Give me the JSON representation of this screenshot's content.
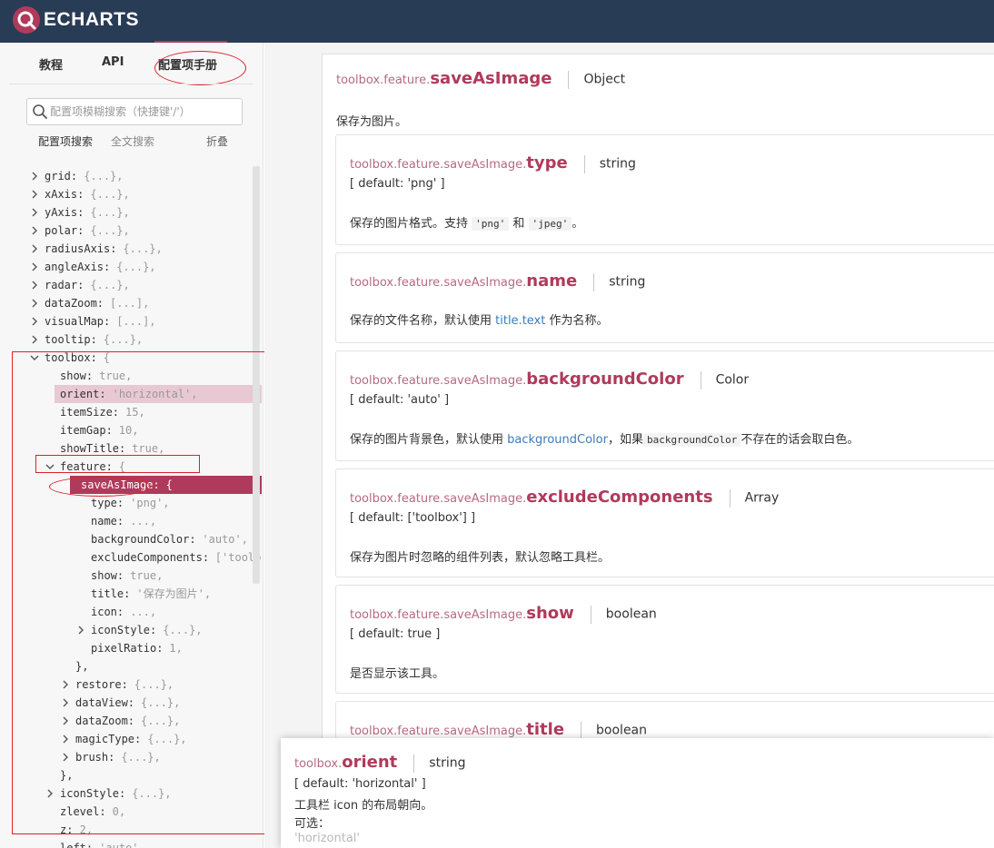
{
  "app": {
    "logo_text": "ECHARTS",
    "brand_color": "#b03a5b",
    "topbar_color": "#293c55"
  },
  "nav": {
    "tabs": [
      {
        "label": "教程"
      },
      {
        "label": "API"
      },
      {
        "label": "配置项手册",
        "active": true
      }
    ]
  },
  "search": {
    "placeholder": "配置项模糊搜索（快捷键'/'）",
    "modes": [
      {
        "label": "配置项搜索",
        "active": true
      },
      {
        "label": "全文搜索"
      }
    ],
    "collapse_label": "折叠"
  },
  "tree": [
    {
      "indent": 0,
      "arrow": "right",
      "key": "grid:",
      "val": "{...},",
      "hl": ""
    },
    {
      "indent": 0,
      "arrow": "right",
      "key": "xAxis:",
      "val": "{...},",
      "hl": ""
    },
    {
      "indent": 0,
      "arrow": "right",
      "key": "yAxis:",
      "val": "{...},",
      "hl": ""
    },
    {
      "indent": 0,
      "arrow": "right",
      "key": "polar:",
      "val": "{...},",
      "hl": ""
    },
    {
      "indent": 0,
      "arrow": "right",
      "key": "radiusAxis:",
      "val": "{...},",
      "hl": ""
    },
    {
      "indent": 0,
      "arrow": "right",
      "key": "angleAxis:",
      "val": "{...},",
      "hl": ""
    },
    {
      "indent": 0,
      "arrow": "right",
      "key": "radar:",
      "val": "{...},",
      "hl": ""
    },
    {
      "indent": 0,
      "arrow": "right",
      "key": "dataZoom:",
      "val": "[...],",
      "hl": ""
    },
    {
      "indent": 0,
      "arrow": "right",
      "key": "visualMap:",
      "val": "[...],",
      "hl": ""
    },
    {
      "indent": 0,
      "arrow": "right",
      "key": "tooltip:",
      "val": "{...},",
      "hl": ""
    },
    {
      "indent": 0,
      "arrow": "down",
      "key": "toolbox:",
      "val": "{",
      "hl": ""
    },
    {
      "indent": 1,
      "arrow": "",
      "key": "show:",
      "val": "true,",
      "hl": ""
    },
    {
      "indent": 1,
      "arrow": "",
      "key": "orient:",
      "val": "'horizontal',",
      "hl": "light"
    },
    {
      "indent": 1,
      "arrow": "",
      "key": "itemSize:",
      "val": "15,",
      "hl": ""
    },
    {
      "indent": 1,
      "arrow": "",
      "key": "itemGap:",
      "val": "10,",
      "hl": ""
    },
    {
      "indent": 1,
      "arrow": "",
      "key": "showTitle:",
      "val": "true,",
      "hl": ""
    },
    {
      "indent": 1,
      "arrow": "down",
      "key": "feature:",
      "val": "{",
      "hl": ""
    },
    {
      "indent": 2,
      "arrow": "down",
      "key": "saveAsImage:",
      "val": "{",
      "hl": "dark"
    },
    {
      "indent": 3,
      "arrow": "",
      "key": "type:",
      "val": "'png',",
      "hl": ""
    },
    {
      "indent": 3,
      "arrow": "",
      "key": "name:",
      "val": "...,",
      "hl": ""
    },
    {
      "indent": 3,
      "arrow": "",
      "key": "backgroundColor:",
      "val": "'auto',",
      "hl": ""
    },
    {
      "indent": 3,
      "arrow": "",
      "key": "excludeComponents:",
      "val": "['toolbox'],",
      "hl": ""
    },
    {
      "indent": 3,
      "arrow": "",
      "key": "show:",
      "val": "true,",
      "hl": ""
    },
    {
      "indent": 3,
      "arrow": "",
      "key": "title:",
      "val": "'保存为图片',",
      "hl": ""
    },
    {
      "indent": 3,
      "arrow": "",
      "key": "icon:",
      "val": "...,",
      "hl": ""
    },
    {
      "indent": 3,
      "arrow": "right",
      "key": "iconStyle:",
      "val": "{...},",
      "hl": ""
    },
    {
      "indent": 3,
      "arrow": "",
      "key": "pixelRatio:",
      "val": "1,",
      "hl": ""
    },
    {
      "indent": 2,
      "arrow": "",
      "key": "},",
      "val": "",
      "hl": ""
    },
    {
      "indent": 2,
      "arrow": "right",
      "key": "restore:",
      "val": "{...},",
      "hl": ""
    },
    {
      "indent": 2,
      "arrow": "right",
      "key": "dataView:",
      "val": "{...},",
      "hl": ""
    },
    {
      "indent": 2,
      "arrow": "right",
      "key": "dataZoom:",
      "val": "{...},",
      "hl": ""
    },
    {
      "indent": 2,
      "arrow": "right",
      "key": "magicType:",
      "val": "{...},",
      "hl": ""
    },
    {
      "indent": 2,
      "arrow": "right",
      "key": "brush:",
      "val": "{...},",
      "hl": ""
    },
    {
      "indent": 1,
      "arrow": "",
      "key": "},",
      "val": "",
      "hl": ""
    },
    {
      "indent": 1,
      "arrow": "right",
      "key": "iconStyle:",
      "val": "{...},",
      "hl": ""
    },
    {
      "indent": 1,
      "arrow": "",
      "key": "zlevel:",
      "val": "0,",
      "hl": ""
    },
    {
      "indent": 1,
      "arrow": "",
      "key": "z:",
      "val": "2,",
      "hl": ""
    },
    {
      "indent": 1,
      "arrow": "",
      "key": "left:",
      "val": "'auto',",
      "hl": ""
    }
  ],
  "doc": {
    "prefix": "toolbox.feature.",
    "name": "saveAsImage",
    "type": "Object",
    "desc": "保存为图片。"
  },
  "cards": [
    {
      "prefix": "toolbox.feature.saveAsImage.",
      "name": "type",
      "type": "string",
      "default": "[ default: 'png' ]",
      "desc_parts": [
        {
          "t": "保存的图片格式。支持 ",
          "k": "text"
        },
        {
          "t": "'png'",
          "k": "code"
        },
        {
          "t": " 和 ",
          "k": "text"
        },
        {
          "t": "'jpeg'",
          "k": "code"
        },
        {
          "t": "。",
          "k": "text"
        }
      ]
    },
    {
      "prefix": "toolbox.feature.saveAsImage.",
      "name": "name",
      "type": "string",
      "default": "",
      "desc_parts": [
        {
          "t": "保存的文件名称，默认使用 ",
          "k": "text"
        },
        {
          "t": "title.text",
          "k": "link"
        },
        {
          "t": " 作为名称。",
          "k": "text"
        }
      ]
    },
    {
      "prefix": "toolbox.feature.saveAsImage.",
      "name": "backgroundColor",
      "type": "Color",
      "default": "[ default: 'auto' ]",
      "desc_parts": [
        {
          "t": "保存的图片背景色，默认使用 ",
          "k": "text"
        },
        {
          "t": "backgroundColor",
          "k": "link"
        },
        {
          "t": "，如果",
          "k": "text"
        },
        {
          "t": "backgroundColor",
          "k": "code"
        },
        {
          "t": "不存在的话会取白色。",
          "k": "text"
        }
      ]
    },
    {
      "prefix": "toolbox.feature.saveAsImage.",
      "name": "excludeComponents",
      "type": "Array",
      "default": "[ default: ['toolbox'] ]",
      "desc_parts": [
        {
          "t": "保存为图片时忽略的组件列表，默认忽略工具栏。",
          "k": "text"
        }
      ]
    },
    {
      "prefix": "toolbox.feature.saveAsImage.",
      "name": "show",
      "type": "boolean",
      "default": "[ default: true ]",
      "desc_parts": [
        {
          "t": "是否显示该工具。",
          "k": "text"
        }
      ]
    },
    {
      "prefix": "toolbox.feature.saveAsImage.",
      "name": "title",
      "type": "boolean",
      "default": "",
      "desc_parts": []
    }
  ],
  "popup": {
    "prefix": "toolbox.",
    "name": "orient",
    "type": "string",
    "default": "[ default: 'horizontal' ]",
    "desc": "工具栏 icon 的布局朝向。",
    "options_label": "可选：",
    "option_first": "'horizontal'"
  }
}
